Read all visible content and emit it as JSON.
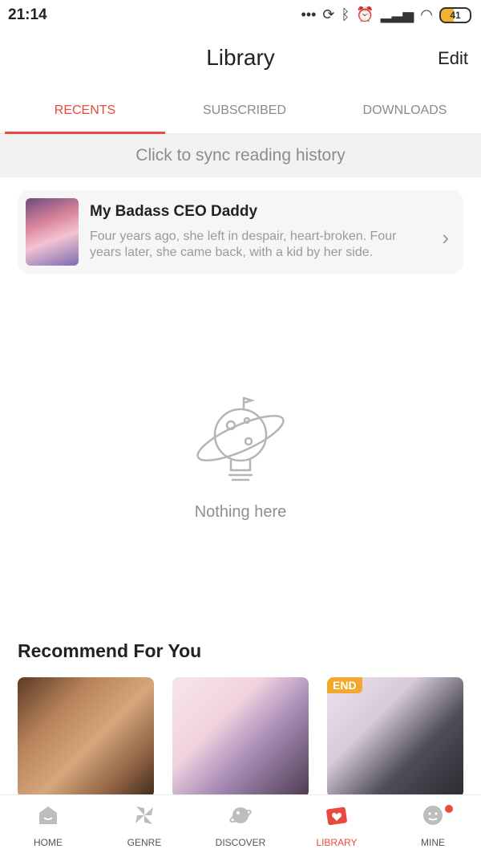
{
  "status_bar": {
    "time": "21:14",
    "battery": "41"
  },
  "header": {
    "title": "Library",
    "edit_label": "Edit"
  },
  "tabs": [
    {
      "label": "RECENTS",
      "active": true
    },
    {
      "label": "SUBSCRIBED",
      "active": false
    },
    {
      "label": "DOWNLOADS",
      "active": false
    }
  ],
  "sync_bar": {
    "text": "Click to sync reading history"
  },
  "recent": {
    "title": "My Badass CEO Daddy",
    "description": "Four years ago, she left in despair, heart-broken. Four years later, she came back, with a kid by her side."
  },
  "empty_state": {
    "text": "Nothing here"
  },
  "recommend": {
    "title": "Recommend For You",
    "items": [
      {
        "badge": ""
      },
      {
        "badge": ""
      },
      {
        "badge": "END"
      }
    ]
  },
  "bottom_nav": [
    {
      "label": "HOME",
      "icon": "home-icon"
    },
    {
      "label": "GENRE",
      "icon": "genre-icon"
    },
    {
      "label": "DISCOVER",
      "icon": "discover-icon"
    },
    {
      "label": "LIBRARY",
      "icon": "library-icon",
      "active": true
    },
    {
      "label": "MINE",
      "icon": "mine-icon"
    }
  ],
  "colors": {
    "accent": "#e9493f",
    "badge": "#f2a82d"
  }
}
